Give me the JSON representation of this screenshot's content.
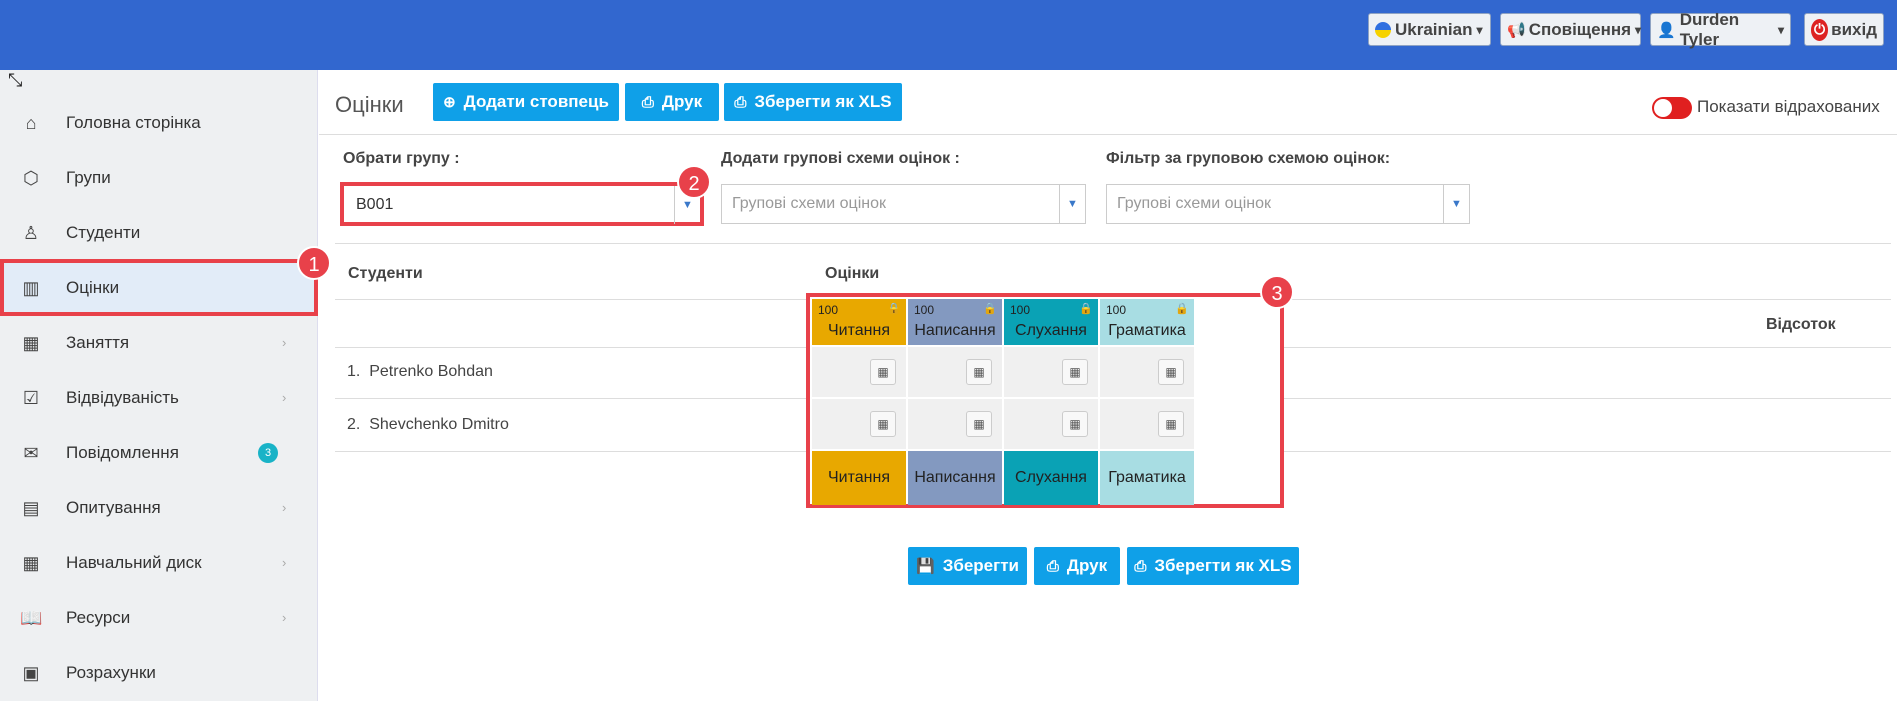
{
  "topbar": {
    "language": "Ukrainian",
    "notifications": "Сповіщення",
    "user": "Durden Tyler",
    "logout": "вихід"
  },
  "sidebar": {
    "items": [
      {
        "label": "Головна сторінка"
      },
      {
        "label": "Групи"
      },
      {
        "label": "Студенти"
      },
      {
        "label": "Оцінки"
      },
      {
        "label": "Заняття"
      },
      {
        "label": "Відвідуваність"
      },
      {
        "label": "Повідомлення",
        "badge": "3"
      },
      {
        "label": "Опитування"
      },
      {
        "label": "Навчальний диск"
      },
      {
        "label": "Ресурси"
      },
      {
        "label": "Розрахунки"
      }
    ]
  },
  "main": {
    "title": "Оцінки",
    "add_column": "Додати стовпець",
    "print": "Друк",
    "save_xls": "Зберегти як XLS",
    "show_expelled": "Показати відрахованих",
    "select_group_label": "Обрати групу :",
    "select_group_value": "B001",
    "add_schemes_label": "Додати групові схеми оцінок :",
    "add_schemes_placeholder": "Групові схеми оцінок",
    "filter_label": "Фільтр за груповою схемою оцінок:",
    "filter_placeholder": "Групові схеми оцінок",
    "students_header": "Студенти",
    "grades_header": "Оцінки",
    "percent_header": "Відсоток",
    "students": [
      {
        "num": "1.",
        "name": "Petrenko Bohdan"
      },
      {
        "num": "2.",
        "name": "Shevchenko Dmitro"
      }
    ],
    "grade_columns": [
      {
        "max": "100",
        "name": "Читання",
        "color": "#e8a800"
      },
      {
        "max": "100",
        "name": "Написання",
        "color": "#8399c0"
      },
      {
        "max": "100",
        "name": "Слухання",
        "color": "#0aa2b5"
      },
      {
        "max": "100",
        "name": "Граматика",
        "color": "#a8dde3"
      }
    ],
    "save": "Зберегти",
    "print_bottom": "Друк",
    "save_xls_bottom": "Зберегти як XLS"
  },
  "markers": [
    "1",
    "2",
    "3"
  ]
}
